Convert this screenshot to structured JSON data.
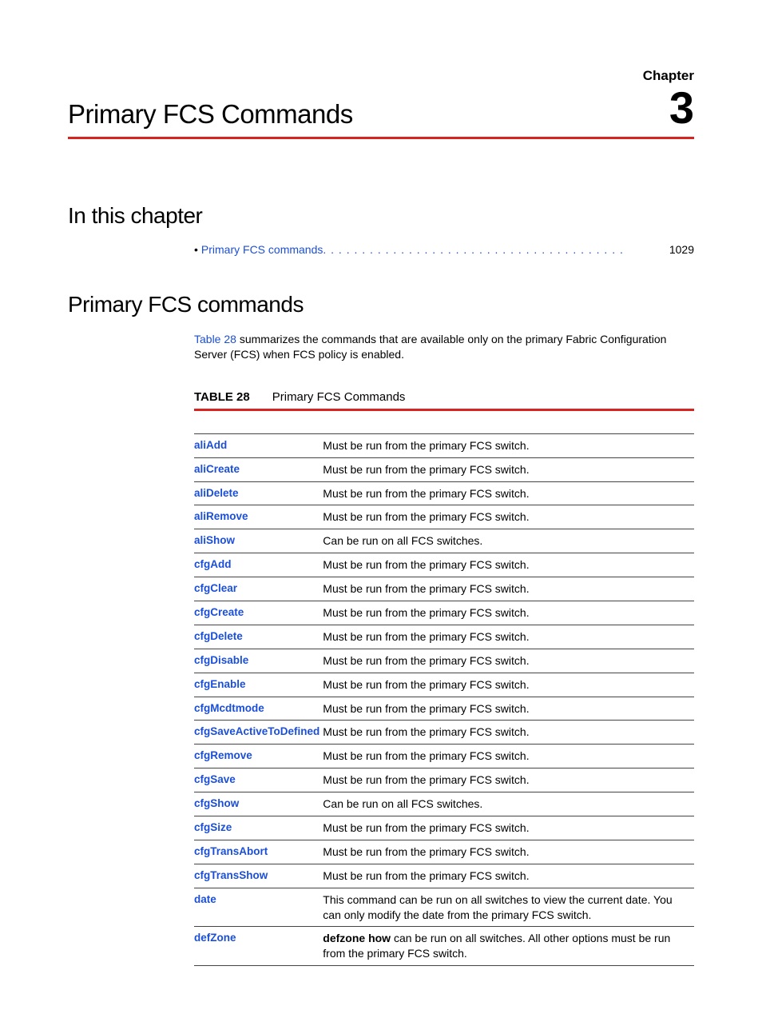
{
  "chapter_label": "Chapter",
  "chapter_number": "3",
  "page_title": "Primary FCS Commands",
  "h_in_chapter": "In this chapter",
  "toc": {
    "bullet": "•",
    "text": "Primary FCS commands",
    "page": "1029"
  },
  "h_commands": "Primary FCS commands",
  "intro": {
    "ref": "Table 28",
    "rest": " summarizes the commands that are available only on the primary Fabric Configuration Server (FCS) when FCS policy is enabled."
  },
  "table": {
    "label": "TABLE 28",
    "title": "Primary FCS Commands",
    "rows": [
      {
        "cmd": "aliAdd",
        "desc": "Must be run from the primary FCS switch."
      },
      {
        "cmd": "aliCreate",
        "desc": "Must be run from the primary FCS switch."
      },
      {
        "cmd": "aliDelete",
        "desc": "Must be run from the primary FCS switch."
      },
      {
        "cmd": "aliRemove",
        "desc": "Must be run from the primary FCS switch."
      },
      {
        "cmd": "aliShow",
        "desc": "Can be run on all FCS switches."
      },
      {
        "cmd": "cfgAdd",
        "desc": "Must be run from the primary FCS switch."
      },
      {
        "cmd": "cfgClear",
        "desc": "Must be run from the primary FCS switch."
      },
      {
        "cmd": "cfgCreate",
        "desc": "Must be run from the primary FCS switch."
      },
      {
        "cmd": "cfgDelete",
        "desc": "Must be run from the primary FCS switch."
      },
      {
        "cmd": "cfgDisable",
        "desc": "Must be run from the primary FCS switch."
      },
      {
        "cmd": "cfgEnable",
        "desc": "Must be run from the primary FCS switch."
      },
      {
        "cmd": "cfgMcdtmode",
        "desc": "Must be run from the primary FCS switch."
      },
      {
        "cmd": "cfgSaveActiveToDefined",
        "desc": "Must be run from the primary FCS switch."
      },
      {
        "cmd": "cfgRemove",
        "desc": "Must be run from the primary FCS switch."
      },
      {
        "cmd": "cfgSave",
        "desc": "Must be run from the primary FCS switch."
      },
      {
        "cmd": "cfgShow",
        "desc": "Can be run on all FCS switches."
      },
      {
        "cmd": "cfgSize",
        "desc": "Must be run from the primary FCS switch."
      },
      {
        "cmd": "cfgTransAbort",
        "desc": "Must be run from the primary FCS switch."
      },
      {
        "cmd": "cfgTransShow",
        "desc": "Must be run from the primary FCS switch."
      },
      {
        "cmd": "date",
        "desc": "This command can be run on all switches to view the current date. You can only modify the date from the primary FCS switch."
      }
    ],
    "defzone": {
      "cmd": "defZone",
      "lead_bold": "defzone",
      "mid_bold": "how",
      "before_mid": " ",
      "after_mid": " can be run on all switches. All other options must be run from the primary FCS switch."
    }
  }
}
